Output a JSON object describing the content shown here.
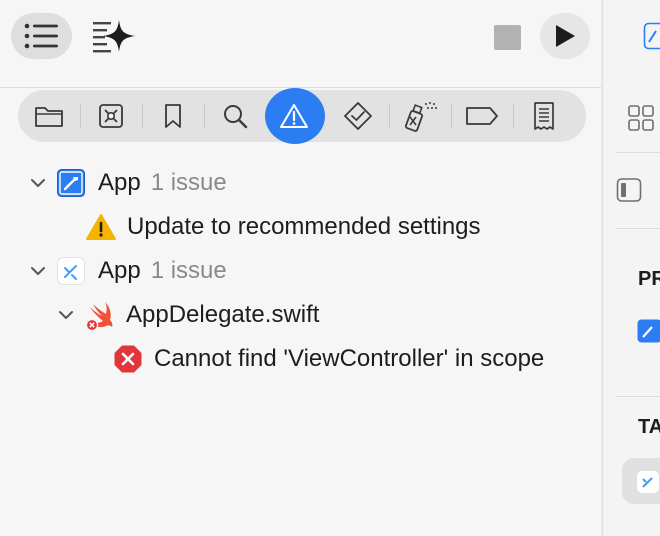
{
  "toolbar": {
    "sidebar_toggle": "list-icon",
    "magic": "sparkle-icon",
    "stop": "stop-icon",
    "run": "play-icon"
  },
  "navigator_tabs": [
    "folder-icon",
    "x-square-icon",
    "bookmark-icon",
    "search-icon",
    "warning-icon",
    "diamond-check-icon",
    "spray-icon",
    "tag-icon",
    "report-icon"
  ],
  "active_tab": "warning-icon",
  "issues": {
    "groups": [
      {
        "name": "App",
        "count": "1 issue",
        "items": [
          {
            "text": "Update to recommended settings",
            "severity": "warning"
          }
        ]
      },
      {
        "name": "App",
        "count": "1 issue",
        "files": [
          {
            "name": "AppDelegate.swift",
            "items": [
              {
                "text": "Cannot find 'ViewController' in scope",
                "severity": "error"
              }
            ]
          }
        ]
      }
    ]
  },
  "inspector": {
    "header1": "PR",
    "header2": "TA"
  },
  "colors": {
    "accent": "#2c7df2",
    "warning": "#f5b400",
    "error": "#e0363b",
    "swift": "#f05138",
    "muted": "#8a8a8e"
  }
}
